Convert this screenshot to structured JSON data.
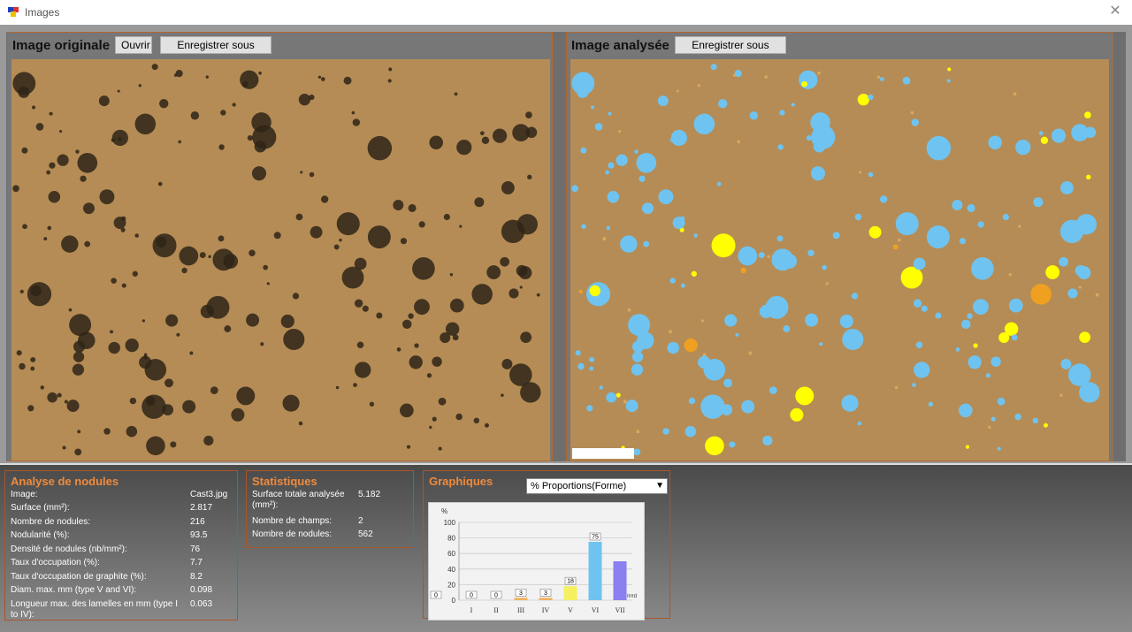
{
  "window": {
    "title": "Images",
    "close_symbol": "✕"
  },
  "left_panel": {
    "title": "Image originale",
    "open_label": "Ouvrir",
    "save_label": "Enregistrer sous"
  },
  "right_panel": {
    "title": "Image analysée",
    "save_label": "Enregistrer sous"
  },
  "nodules": {
    "title": "Analyse de nodules",
    "rows": [
      {
        "label": "Image:",
        "value": "Cast3.jpg"
      },
      {
        "label": "Surface (mm²):",
        "value": "2.817"
      },
      {
        "label": "Nombre de nodules:",
        "value": "216"
      },
      {
        "label": "Nodularité (%):",
        "value": "93.5"
      },
      {
        "label": "Densité de nodules (nb/mm²):",
        "value": "76"
      },
      {
        "label": "Taux d'occupation (%):",
        "value": "7.7"
      },
      {
        "label": "Taux d'occupation de graphite (%):",
        "value": "8.2"
      },
      {
        "label": "Diam. max. mm (type V and VI):",
        "value": "0.098"
      },
      {
        "label": "Longueur max. des lamelles en mm (type I to IV):",
        "value": "0.063"
      }
    ]
  },
  "stats": {
    "title": "Statistiques",
    "rows": [
      {
        "label": "Surface totale analysée (mm²):",
        "value": "5.182"
      },
      {
        "label": "Nombre de champs:",
        "value": "2"
      },
      {
        "label": "Nombre de nodules:",
        "value": "562"
      }
    ]
  },
  "graph": {
    "title": "Graphiques",
    "select_value": "% Proportions(Forme)",
    "colors": {
      "accent": "#f08a3c",
      "border": "#a8562a",
      "cyan": "#6fc3f0",
      "yellow": "#ffff00"
    }
  },
  "chart_data": {
    "type": "bar",
    "ylabel": "%",
    "ylim": [
      0,
      100
    ],
    "yticks": [
      "0",
      "20",
      "40",
      "60",
      "80",
      "100"
    ],
    "categories": [
      "I",
      "II",
      "III",
      "IV",
      "V",
      "VI",
      "VII"
    ],
    "values": [
      0,
      0,
      3,
      3,
      18,
      75,
      50
    ],
    "data_labels": [
      "0",
      "0",
      "3",
      "3",
      "18",
      "75",
      ""
    ],
    "extra_label": "Irrrd"
  }
}
